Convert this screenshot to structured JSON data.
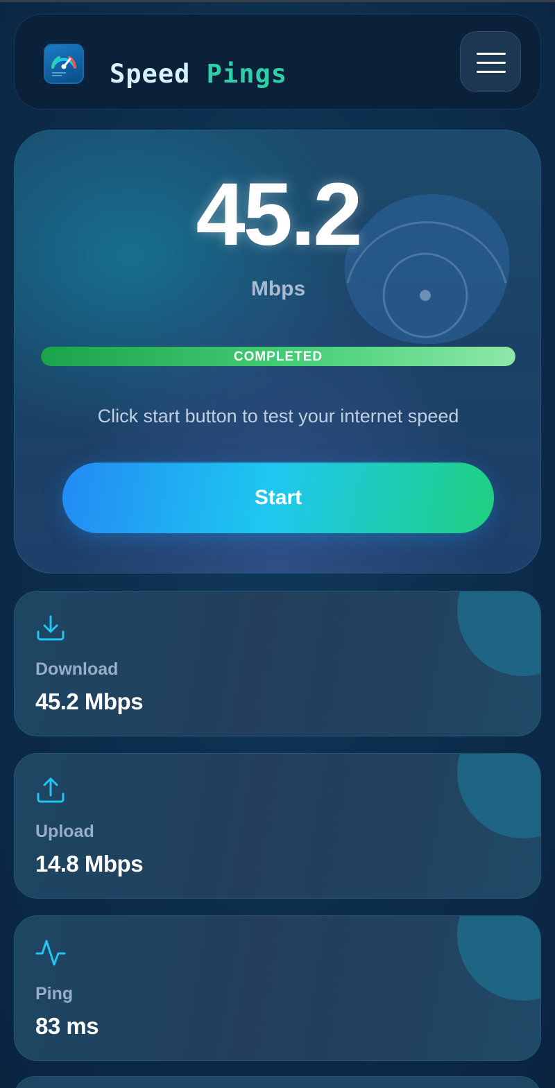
{
  "header": {
    "brand_word1": "Speed",
    "brand_word2": "Pings",
    "logo_icon": "speedometer-icon",
    "menu_icon": "hamburger-menu-icon"
  },
  "speed": {
    "value": "45.2",
    "unit": "Mbps",
    "status": "COMPLETED",
    "progress_fraction": 1.0,
    "hint": "Click start button to test your internet speed",
    "start_label": "Start"
  },
  "stats": [
    {
      "icon": "download-icon",
      "label": "Download",
      "value": "45.2 Mbps"
    },
    {
      "icon": "upload-icon",
      "label": "Upload",
      "value": "14.8 Mbps"
    },
    {
      "icon": "activity-pulse-icon",
      "label": "Ping",
      "value": "83 ms"
    }
  ],
  "colors": {
    "accent_cyan": "#22c6f2",
    "accent_green": "#2fd0a8",
    "progress_green": "#46cf77",
    "background": "#0b2a45"
  }
}
